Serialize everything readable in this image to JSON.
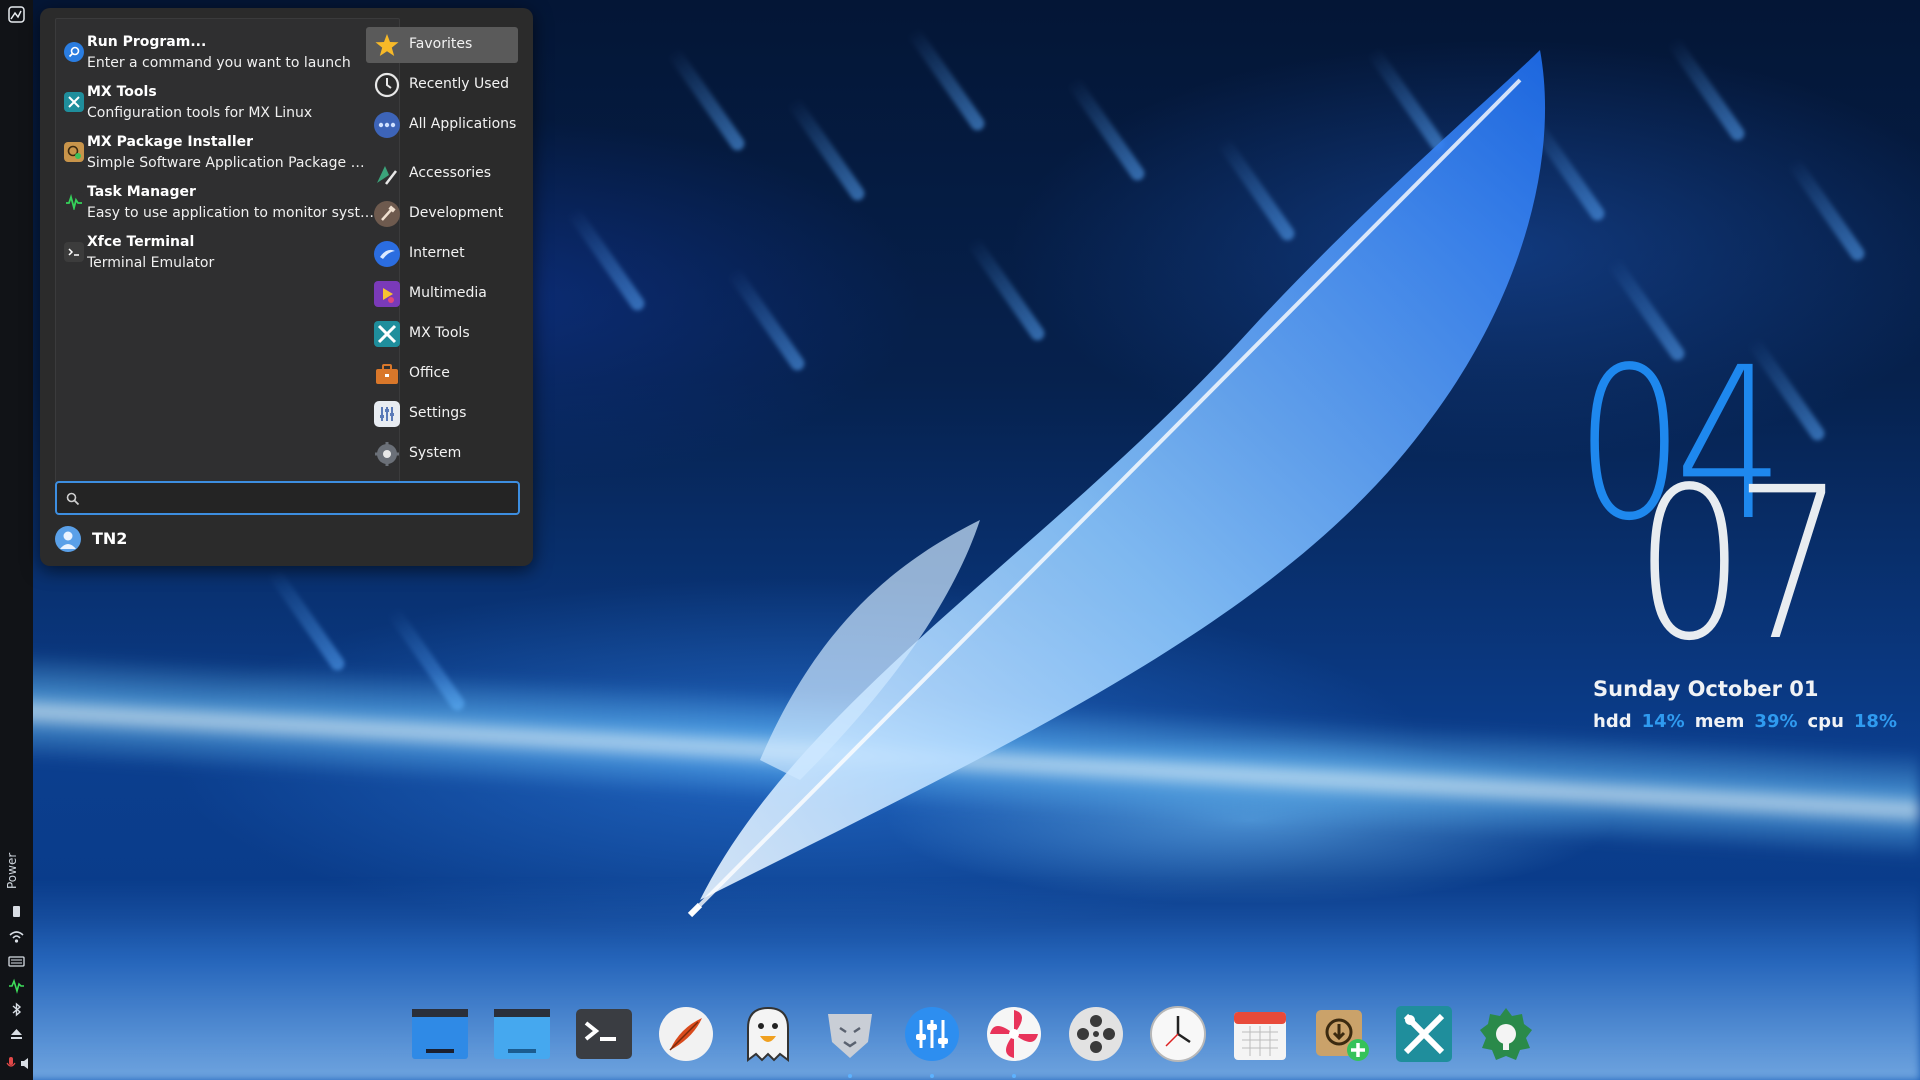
{
  "side_panel": {
    "power_label": "Power"
  },
  "menu": {
    "favorites": [
      {
        "name": "Run Program...",
        "description": "Enter a command you want to launch",
        "icon": "run-program-icon"
      },
      {
        "name": "MX Tools",
        "description": "Configuration tools for MX Linux",
        "icon": "mx-tools-icon"
      },
      {
        "name": "MX Package Installer",
        "description": "Simple Software Application Package …",
        "icon": "package-installer-icon"
      },
      {
        "name": "Task Manager",
        "description": "Easy to use application to monitor syst…",
        "icon": "task-manager-icon"
      },
      {
        "name": "Xfce Terminal",
        "description": "Terminal Emulator",
        "icon": "terminal-icon"
      }
    ],
    "categories": [
      {
        "label": "Favorites",
        "icon": "star-icon",
        "active": true
      },
      {
        "label": "Recently Used",
        "icon": "clock-icon",
        "active": false
      },
      {
        "label": "All Applications",
        "icon": "all-applications-icon",
        "active": false
      },
      {
        "label": "Accessories",
        "icon": "accessories-icon",
        "active": false
      },
      {
        "label": "Development",
        "icon": "development-icon",
        "active": false
      },
      {
        "label": "Internet",
        "icon": "internet-icon",
        "active": false
      },
      {
        "label": "Multimedia",
        "icon": "multimedia-icon",
        "active": false
      },
      {
        "label": "MX Tools",
        "icon": "mx-tools-icon",
        "active": false
      },
      {
        "label": "Office",
        "icon": "office-icon",
        "active": false
      },
      {
        "label": "Settings",
        "icon": "settings-icon",
        "active": false
      },
      {
        "label": "System",
        "icon": "system-icon",
        "active": false
      }
    ],
    "search": {
      "value": "",
      "placeholder": ""
    },
    "user": {
      "name": "TN2"
    }
  },
  "conky": {
    "hour": "04",
    "minute": "07",
    "date": "Sunday October 01",
    "stats": [
      {
        "label": "hdd",
        "value": "14%"
      },
      {
        "label": "mem",
        "value": "39%"
      },
      {
        "label": "cpu",
        "value": "18%"
      }
    ]
  },
  "colors": {
    "accent": "#1e88ee",
    "menu_bg": "#2b2b2b",
    "search_border": "#3d8ee0"
  },
  "dock": [
    {
      "name": "file-manager-icon",
      "running": false
    },
    {
      "name": "file-manager-alt-icon",
      "running": false
    },
    {
      "name": "terminal-icon",
      "running": false
    },
    {
      "name": "feather-icon",
      "running": false
    },
    {
      "name": "ghost-icon",
      "running": false
    },
    {
      "name": "lion-icon",
      "running": true
    },
    {
      "name": "mixer-icon",
      "running": true
    },
    {
      "name": "pinwheel-icon",
      "running": true
    },
    {
      "name": "film-reel-icon",
      "running": false
    },
    {
      "name": "clock-icon",
      "running": false
    },
    {
      "name": "calendar-icon",
      "running": false
    },
    {
      "name": "package-installer-icon",
      "running": false
    },
    {
      "name": "mx-tools-icon",
      "running": false
    },
    {
      "name": "tweak-icon",
      "running": false
    }
  ]
}
